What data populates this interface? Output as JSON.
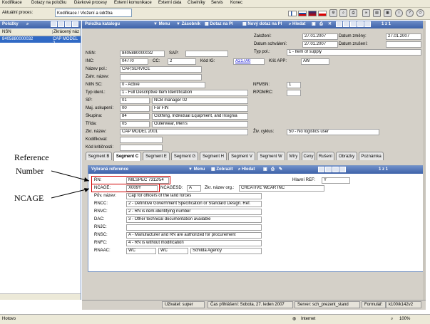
{
  "menu": [
    "Kodifikace",
    "Dotazy na položku",
    "Dávkové procesy",
    "Externí komunikace",
    "Externí data",
    "Číselníky",
    "Servis",
    "Konec"
  ],
  "process": {
    "label": "Aktuální proces:",
    "value": "Kodifikace / Vložení a údržba"
  },
  "left_panel": {
    "title": "Položky",
    "columns": [
      "NSN",
      "Zkrácený náz"
    ],
    "rows": [
      {
        "nsn": "8405880000032",
        "name": "CAP MODEL 2"
      }
    ]
  },
  "catalog": {
    "title": "Položka katalogu",
    "toolbar": {
      "menu": "Menu",
      "zasobnik": "Zásobník",
      "dotaz": "Dotaz na Pl",
      "novy_dotaz": "Nový dotaz na Pl",
      "hledat": "Hledat",
      "pager": "1 z 1"
    },
    "dates": {
      "zalozeni_label": "Založení:",
      "zalozeni": "27.01.2007",
      "zmeny_label": "Datum změny:",
      "zmeny": "27.01.2007",
      "schvaleni_label": "Datum schválení:",
      "schvaleni": "27.01.2007",
      "zruseni_label": "Datum zrušení:",
      "zruseni": ""
    },
    "typ_pol_label": "Typ pol.:",
    "typ_pol": "1 - Item of supply",
    "nsn_label": "NSN:",
    "nsn": "8405880000032",
    "sap_label": "SAP:",
    "sap": "",
    "inc_label": "INC:",
    "inc": "04770",
    "cc_label": "CC:",
    "cc": "2",
    "kod_ig_label": "Kód IG:",
    "kod_ig": "A217A0",
    "klic_app_label": "Klíč APP:",
    "klic_app": "AW",
    "nazev_pol_label": "Název pol.:",
    "nazev_pol": "CAP,SERVICE",
    "zahr_nazev_label": "Zahr. název:",
    "zahr_nazev": "",
    "niin_sc_label": "NIIN SC:",
    "niin_sc": "0 - Active",
    "nfmsn_label": "NFMSN:",
    "nfmsn": "1",
    "typ_ident_label": "Typ ident.:",
    "typ_ident": "1 - Full Descriptive Item Identification",
    "rpdmrc_label": "RPDMRC:",
    "rpdmrc": "",
    "sp_label": "SP:",
    "sp_code": "01",
    "sp_text": "NCB manager 02",
    "maj_label": "Maj. uskupení:",
    "maj_code": "00",
    "maj_text": "For FIN",
    "skupina_label": "Skupina:",
    "skupina_code": "84",
    "skupina_text": "Clothing, Individual Equipment, and Insignia",
    "trida_label": "Třída:",
    "trida_code": "05",
    "trida_text": "Outerwear, Men's",
    "zkr_nazev_label": "Zkr. název:",
    "zkr_nazev": "CAP MODEL 2001",
    "ziv_cyklus_label": "Živ. cyklus:",
    "ziv_cyklus": "50 - No logistics user",
    "kodifikoval_label": "Kodifikoval:",
    "kodifikoval": "",
    "kod_kritic_label": "Kód kritičnosti:",
    "kod_kritic": ""
  },
  "tabs": [
    "Segment B",
    "Segment C",
    "Segment E",
    "Segment G",
    "Segment H",
    "Segment V",
    "Segment W",
    "Míry",
    "Ceny",
    "Rušení",
    "Obrázky",
    "Poznámka"
  ],
  "active_tab": "Segment C",
  "references": {
    "title": "Vybraná reference",
    "toolbar": {
      "menu": "Menu",
      "zobrazit": "Zobrazit",
      "hledat": "Hledat",
      "pager": "1 z 1"
    },
    "rn_label": "RN:",
    "rn": "MILSPEC 7312/54",
    "hlavni_ref_label": "Hlavní REF:",
    "hlavni_ref": "Y",
    "ncage_label": "NCAGE:",
    "ncage": "X009Y",
    "ncagesd_label": "NCAGESD:",
    "ncagesd": "A",
    "zkr_org_label": "Zkr. název org.:",
    "zkr_org": "CREATIVE WEAR INC",
    "puv_nazev_label": "Pův. název:",
    "puv_nazev": "Cap for officers of the land forces",
    "rncc_label": "RNCC:",
    "rncc": "2 - Definitive Government Specification or Standard Design. Ref.",
    "rnvc_label": "RNVC:",
    "rnvc": "2 - RN is item-identifying number",
    "dac_label": "DAC:",
    "dac": "3 - Other technical documentation available",
    "rnjc_label": "RNJC:",
    "rnjc": "",
    "rnsc_label": "RNSC:",
    "rnsc": "A - Manufacturer and RN are authorized for procurement",
    "rnfc_label": "RNFC:",
    "rnfc": "4 - RN is without modification",
    "rnaac_label": "RNAAC:",
    "rnaac_code": "WC",
    "rnaac_code2": "WC",
    "rnaac_text": "Schilda Agency"
  },
  "app_status": {
    "user": "Uživatel: super",
    "login": "Čas přihlášení: Sobota, 27. leden 2007",
    "server": "Server: sch_prezent_stand",
    "form": "Formulář:",
    "form_value": "k100/k142v2"
  },
  "browser_status": {
    "left": "Hotovo",
    "zone": "Internet",
    "zoom": "100%"
  },
  "annotations": {
    "reference_number_line1": "Reference",
    "reference_number_line2": "Number",
    "ncage": "NCAGE"
  }
}
